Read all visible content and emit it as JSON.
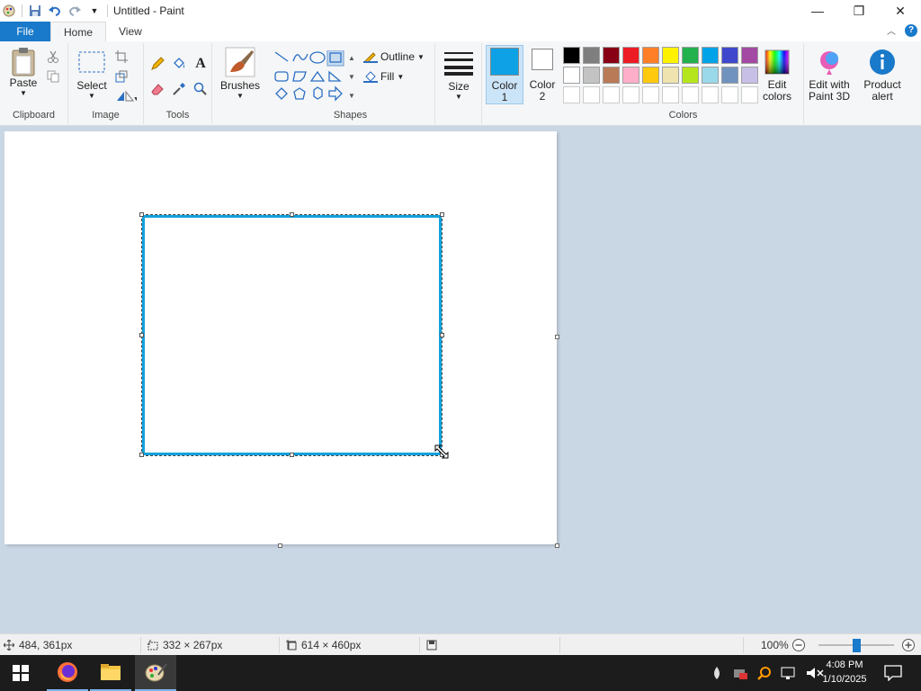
{
  "window": {
    "title": "Untitled - Paint",
    "minimize": "—",
    "restore": "❐",
    "close": "✕"
  },
  "tabs": [
    {
      "label": "File"
    },
    {
      "label": "Home"
    },
    {
      "label": "View"
    }
  ],
  "help_label": "?",
  "ribbon": {
    "clipboard": {
      "paste": "Paste",
      "label": "Clipboard"
    },
    "image": {
      "select": "Select",
      "label": "Image"
    },
    "tools": {
      "label": "Tools",
      "text_tool": "A"
    },
    "brushes": {
      "label": "Brushes"
    },
    "shapes": {
      "label": "Shapes",
      "outline": "Outline",
      "fill": "Fill"
    },
    "size": {
      "label": "Size"
    },
    "color1": {
      "label": "Color\n1",
      "l1": "Color",
      "l2": "1",
      "value": "#0ea1e6"
    },
    "color2": {
      "l1": "Color",
      "l2": "2",
      "value": "#ffffff"
    },
    "colors": {
      "label": "Colors",
      "row1": [
        "#000000",
        "#7f7f7f",
        "#880015",
        "#ed1c24",
        "#ff7f27",
        "#fff200",
        "#22b14c",
        "#00a2e8",
        "#3f48cc",
        "#a349a4"
      ],
      "row2": [
        "#ffffff",
        "#c3c3c3",
        "#b97a57",
        "#ffaec9",
        "#ffc90e",
        "#efe4b0",
        "#b5e61d",
        "#99d9ea",
        "#7092be",
        "#c8bfe7"
      ]
    },
    "edit_colors": {
      "l1": "Edit",
      "l2": "colors"
    },
    "paint3d": {
      "l1": "Edit with",
      "l2": "Paint 3D"
    },
    "product_alert": {
      "l1": "Product",
      "l2": "alert"
    }
  },
  "status": {
    "cursor_pos": "484, 361px",
    "selection_size": "332 × 267px",
    "canvas_size": "614 × 460px",
    "zoom": "100%",
    "zoom_fraction": 0.5
  },
  "taskbar": {
    "time": "4:08 PM",
    "date": "1/10/2025"
  }
}
